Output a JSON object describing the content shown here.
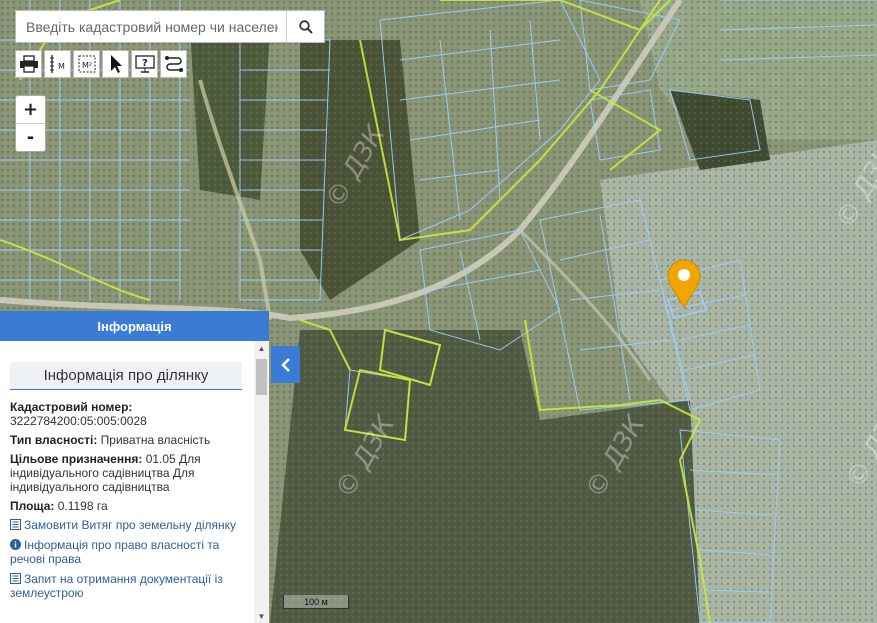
{
  "search": {
    "placeholder": "Введіть кадастровий номер чи населений"
  },
  "toolbar": {
    "tools": [
      "printer-icon",
      "ruler-icon",
      "area-measure-icon",
      "cursor-icon",
      "info-screen-icon",
      "route-icon"
    ]
  },
  "zoom": {
    "in": "+",
    "out": "-"
  },
  "panel": {
    "header": "Інформація",
    "title": "Інформація про ділянку",
    "cadastral_label": "Кадастровий номер:",
    "cadastral_value": "3222784200:05:005:0028",
    "ownership_label": "Тип власності:",
    "ownership_value": "Приватна власність",
    "purpose_label": "Цільове призначення:",
    "purpose_value": "01.05 Для індивідуального садівництва Для індивідуального садівництва",
    "area_label": "Площа:",
    "area_value": "0.1198 га",
    "link_order": "Замовити Витяг про земельну ділянку",
    "link_rights": "Інформація про право власності та речові права",
    "link_docs": "Запит на отримання документації із землеустрою"
  },
  "scale": {
    "label": "100 м"
  },
  "watermark": "© ДЗК",
  "colors": {
    "accent": "#3a7bd5",
    "marker": "#f0a500",
    "parcel": "#9fd0ff",
    "boundary": "#c9ea3a"
  }
}
